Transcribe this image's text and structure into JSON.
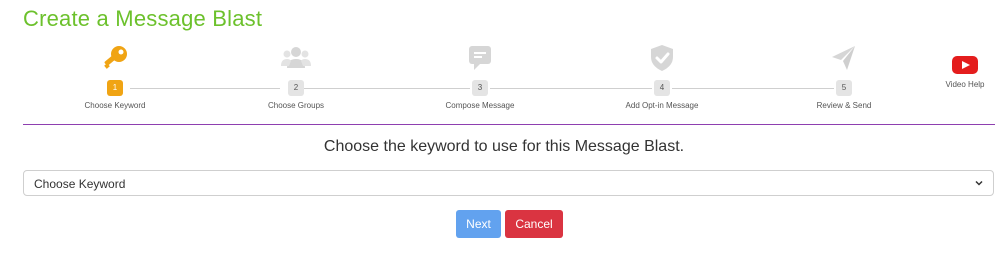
{
  "page": {
    "title": "Create a Message Blast"
  },
  "steps": [
    {
      "number": "1",
      "label": "Choose Keyword",
      "icon": "key-icon",
      "active": true,
      "color": "#f0a414"
    },
    {
      "number": "2",
      "label": "Choose Groups",
      "icon": "users-icon",
      "active": false
    },
    {
      "number": "3",
      "label": "Compose Message",
      "icon": "message-icon",
      "active": false
    },
    {
      "number": "4",
      "label": "Add Opt-in Message",
      "icon": "shield-check-icon",
      "active": false
    },
    {
      "number": "5",
      "label": "Review & Send",
      "icon": "send-icon",
      "active": false
    }
  ],
  "video_help": {
    "label": "Video Help",
    "icon": "youtube-icon",
    "color": "#e41d1d"
  },
  "prompt": "Choose the keyword to use for this Message Blast.",
  "keyword_select": {
    "value": "Choose Keyword"
  },
  "buttons": {
    "next": "Next",
    "cancel": "Cancel"
  },
  "colors": {
    "title": "#6cc12c",
    "divider": "#8e3fb0",
    "next": "#62a2ef",
    "cancel": "#da3441",
    "inactive_icon": "#d6d6d6"
  }
}
